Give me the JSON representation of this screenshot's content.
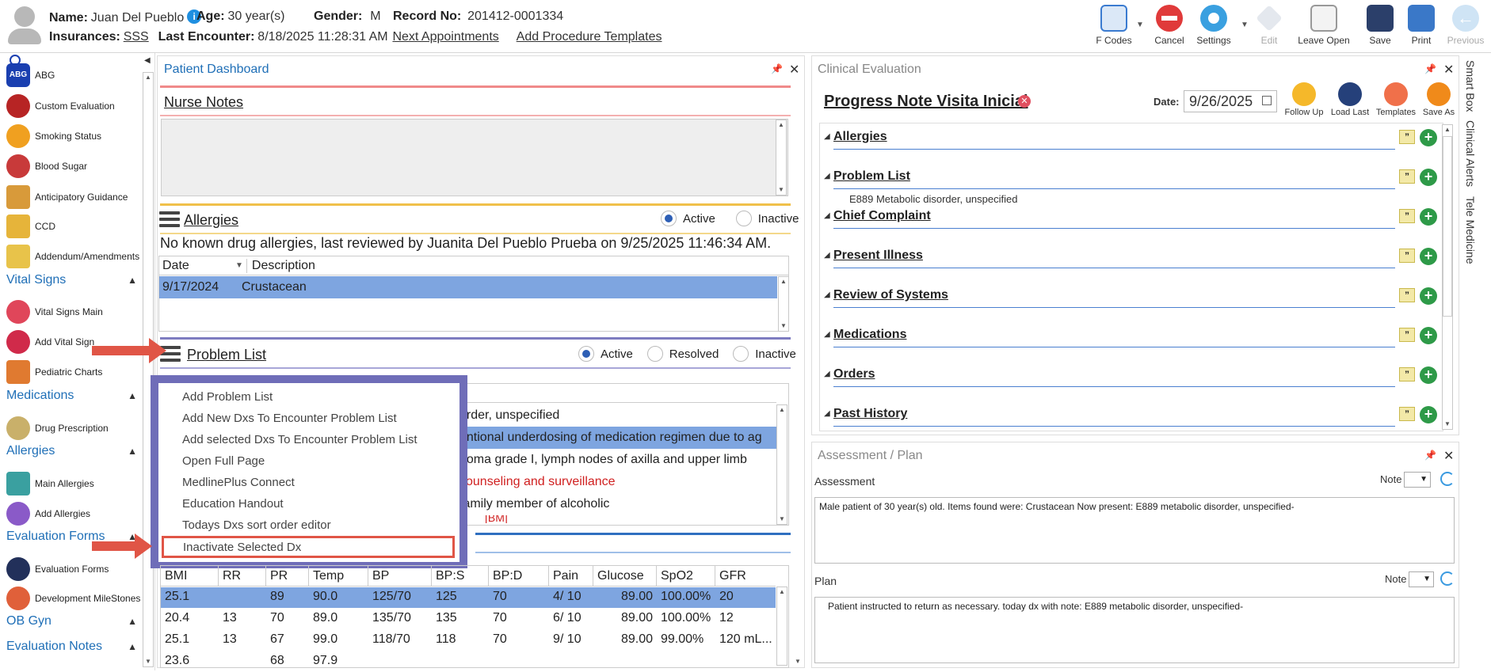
{
  "header": {
    "name_label": "Name:",
    "name": "Juan Del Pueblo",
    "age_label": "Age:",
    "age": "30 year(s)",
    "gender_label": "Gender:",
    "gender": "M",
    "record_label": "Record No:",
    "record": "201412-0001334",
    "insurance_label": "Insurances:",
    "insurance": "SSS",
    "last_encounter_label": "Last Encounter:",
    "last_encounter": "8/18/2025 11:28:31 AM",
    "next_appointments": "Next Appointments",
    "add_procedure_templates": "Add Procedure Templates"
  },
  "toolbar": {
    "fcodes": "F Codes",
    "cancel": "Cancel",
    "settings": "Settings",
    "edit": "Edit",
    "leave_open": "Leave Open",
    "save": "Save",
    "print": "Print",
    "previous": "Previous"
  },
  "sidebar": {
    "items_top": [
      {
        "label": "ABG",
        "icon": "abg-icon",
        "color": "#1a3fb0"
      },
      {
        "label": "Custom Evaluation",
        "icon": "stethoscope-icon",
        "color": "#b72424"
      },
      {
        "label": "Smoking Status",
        "icon": "no-smoking-icon",
        "color": "#f0a020"
      },
      {
        "label": "Blood Sugar",
        "icon": "blood-drop-icon",
        "color": "#c83a3a"
      },
      {
        "label": "Anticipatory Guidance",
        "icon": "abacus-icon",
        "color": "#d89a3a"
      },
      {
        "label": "CCD",
        "icon": "id-card-icon",
        "color": "#e6b43a"
      },
      {
        "label": "Addendum/Amendments",
        "icon": "document-icon",
        "color": "#e8c34a"
      }
    ],
    "vital_signs": "Vital Signs",
    "vital_items": [
      {
        "label": "Vital Signs Main",
        "icon": "heartbeat-icon",
        "color": "#e0465a"
      },
      {
        "label": "Add Vital Sign",
        "icon": "heart-plus-icon",
        "color": "#d02a4a"
      },
      {
        "label": "Pediatric Charts",
        "icon": "chart-icon",
        "color": "#e07a30"
      }
    ],
    "medications": "Medications",
    "med_items": [
      {
        "label": "Drug Prescription",
        "icon": "pills-icon",
        "color": "#c9b06a"
      }
    ],
    "allergies": "Allergies",
    "allergy_items": [
      {
        "label": "Main Allergies",
        "icon": "medkit-icon",
        "color": "#3aa0a0"
      },
      {
        "label": "Add Allergies",
        "icon": "allergy-dots-icon",
        "color": "#8a5ac8"
      }
    ],
    "evaluation_forms": "Evaluation Forms",
    "eval_items": [
      {
        "label": "Evaluation Forms",
        "icon": "forms-icon",
        "color": "#22305a"
      },
      {
        "label": "Development MileStones",
        "icon": "milestone-icon",
        "color": "#e0603a"
      }
    ],
    "ob_gyn": "OB Gyn",
    "evaluation_notes": "Evaluation Notes"
  },
  "dashboard": {
    "title": "Patient Dashboard",
    "nurse_notes": "Nurse Notes",
    "allergies_title": "Allergies",
    "allergies_active": "Active",
    "allergies_inactive": "Inactive",
    "allergy_summary": "No known drug allergies, last reviewed by Juanita Del Pueblo Prueba on 9/25/2025 11:46:34 AM.",
    "allergy_cols": [
      "Date",
      "Description"
    ],
    "allergy_rows": [
      {
        "date": "9/17/2024",
        "desc": "Crustacean"
      }
    ],
    "problem_title": "Problem List",
    "problem_active": "Active",
    "problem_resolved": "Resolved",
    "problem_inactive": "Inactive",
    "problem_rows": [
      {
        "text": "order, unspecified",
        "style": "normal"
      },
      {
        "text": "entional underdosing of medication regimen due to ag",
        "style": "selected"
      },
      {
        "text": "homa grade I, lymph nodes of axilla and upper limb",
        "style": "normal"
      },
      {
        "text": "counseling and surveillance",
        "style": "red"
      },
      {
        "text": "family member of alcoholic",
        "style": "normal"
      }
    ],
    "context_menu": [
      "Add Problem List",
      "Add New Dxs To Encounter Problem List",
      "Add selected Dxs To Encounter Problem List",
      "Open Full Page",
      "MedlinePlus Connect",
      "Education Handout",
      "Todays Dxs sort order editor",
      "Inactivate Selected Dx"
    ],
    "vitals_cols": [
      "BMI",
      "RR",
      "PR",
      "Temp",
      "BP",
      "BP:S",
      "BP:D",
      "Pain",
      "Glucose",
      "SpO2",
      "GFR"
    ],
    "vitals_rows": [
      [
        "25.1",
        "",
        "89",
        "90.0",
        "125/70",
        "125",
        "70",
        "4/ 10",
        "89.00",
        "100.00%",
        "20"
      ],
      [
        "20.4",
        "13",
        "70",
        "89.0",
        "135/70",
        "135",
        "70",
        "6/ 10",
        "89.00",
        "100.00%",
        "12"
      ],
      [
        "25.1",
        "13",
        "67",
        "99.0",
        "118/70",
        "118",
        "70",
        "9/ 10",
        "89.00",
        "99.00%",
        "120 mL..."
      ],
      [
        "23.6",
        "",
        "68",
        "97.9",
        "",
        "",
        "",
        "",
        "",
        "",
        ""
      ]
    ]
  },
  "clinical": {
    "title": "Clinical Evaluation",
    "note_title": "Progress Note Visita Inicial",
    "date_label": "Date:",
    "date": "9/26/2025",
    "follow_up": "Follow Up",
    "load_last": "Load Last",
    "templates": "Templates",
    "save_as": "Save As",
    "sections": [
      {
        "name": "Allergies",
        "content": ""
      },
      {
        "name": "Problem List",
        "content": "E889 Metabolic disorder, unspecified"
      },
      {
        "name": "Chief Complaint",
        "content": ""
      },
      {
        "name": "Present Illness",
        "content": ""
      },
      {
        "name": "Review of Systems",
        "content": ""
      },
      {
        "name": "Medications",
        "content": ""
      },
      {
        "name": "Orders",
        "content": ""
      },
      {
        "name": "Past History",
        "content": ""
      }
    ],
    "quote_glyph": "”",
    "plus_glyph": "+"
  },
  "right_tabs": {
    "smart_box": "Smart Box",
    "clinical_alerts": "Clinical Alerts",
    "tele_medicine": "Tele Medicine"
  },
  "assessment": {
    "title": "Assessment / Plan",
    "assessment_label": "Assessment",
    "note_label": "Note",
    "assessment_text": "Male patient of 30 year(s) old. Items found were:  Crustacean  Now present: E889 metabolic disorder, unspecified-",
    "plan_label": "Plan",
    "plan_note_label": "Note",
    "plan_text": "Patient instructed to return as necessary.  today dx with note: E889 metabolic disorder, unspecified-"
  },
  "colors": {
    "accent_blue": "#1f6fb7",
    "menu_border": "#6f6db8",
    "arrow_red": "#e05546",
    "selection": "#7ea5e0"
  }
}
